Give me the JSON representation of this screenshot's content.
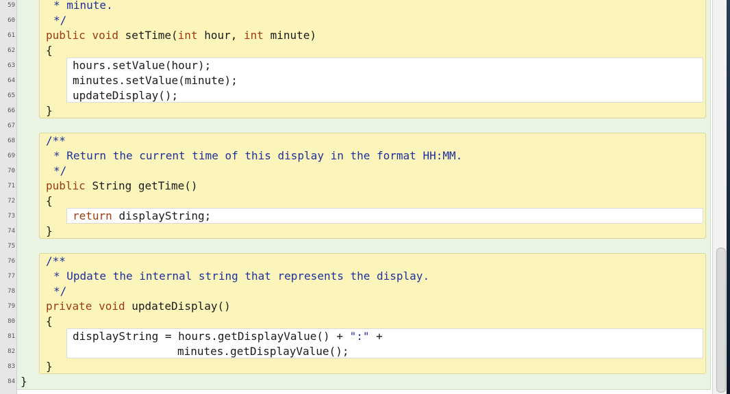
{
  "line_numbers": [
    "59",
    "60",
    "61",
    "62",
    "63",
    "64",
    "65",
    "66",
    "67",
    "68",
    "69",
    "70",
    "71",
    "72",
    "73",
    "74",
    "75",
    "76",
    "77",
    "78",
    "79",
    "80",
    "81",
    "82",
    "83",
    "84"
  ],
  "code": {
    "set_time": {
      "comment_tail_1": "* minute.",
      "comment_end": "*/",
      "kw_public": "public",
      "kw_void": "void",
      "sig_name": "setTime(",
      "kw_int1": "int",
      "param1": "hour,",
      "kw_int2": "int",
      "param2": "minute)",
      "open_brace": "{",
      "body_1": "hours.setValue(hour);",
      "body_2": "minutes.setValue(minute);",
      "body_3": "updateDisplay();",
      "close_brace": "}"
    },
    "get_time": {
      "comment_start": "/**",
      "comment_text": "* Return the current time of this display in the format HH:MM.",
      "comment_end": "*/",
      "kw_public": "public",
      "sig_rest": "String getTime()",
      "open_brace": "{",
      "kw_return": "return",
      "body_rest": "displayString;",
      "close_brace": "}"
    },
    "update_display": {
      "comment_start": "/**",
      "comment_text": "* Update the internal string that represents the display.",
      "comment_end": "*/",
      "kw_private": "private",
      "kw_void": "void",
      "sig_name": "updateDisplay()",
      "open_brace": "{",
      "body_1a": "displayString = hours.getDisplayValue() + ",
      "body_1_str": "\":\"",
      "body_1b": " +",
      "body_2": "minutes.getDisplayValue();",
      "close_brace": "}"
    },
    "class_close": "}"
  }
}
